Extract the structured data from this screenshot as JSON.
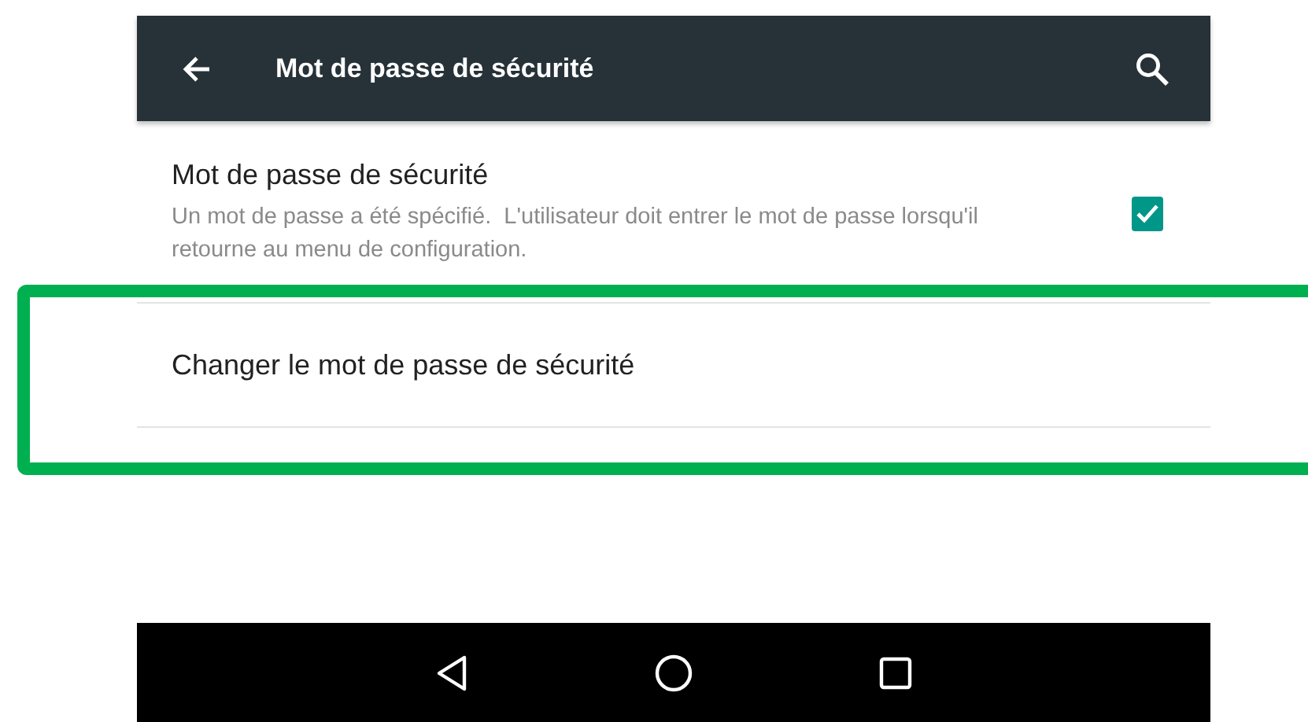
{
  "app_bar": {
    "title": "Mot de passe de sécurité"
  },
  "settings": [
    {
      "kind": "checkbox",
      "title": "Mot de passe de sécurité",
      "summary": "Un mot de passe a été spécifié.  L'utilisateur doit entrer le mot de passe lorsqu'il retourne au menu de configuration.",
      "checked": true
    },
    {
      "kind": "action",
      "title": "Changer le mot de passe de sécurité"
    }
  ]
}
